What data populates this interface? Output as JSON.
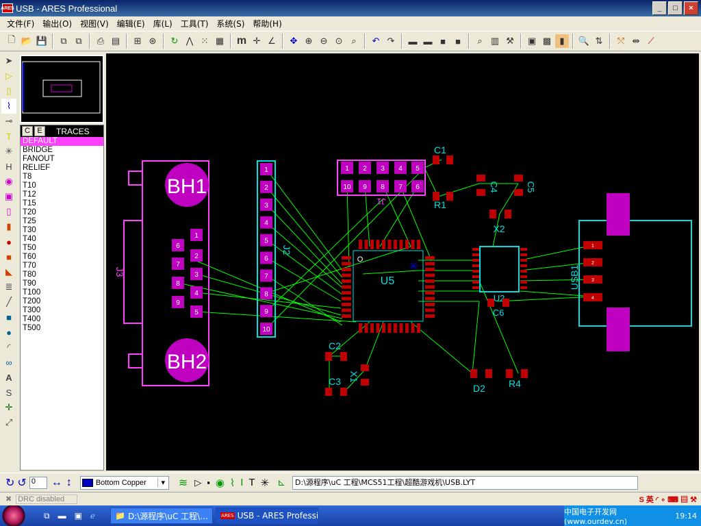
{
  "window": {
    "title": "USB - ARES Professional",
    "icon_text": "ARES"
  },
  "menu": [
    "文件(F)",
    "输出(O)",
    "视图(V)",
    "编辑(E)",
    "库(L)",
    "工具(T)",
    "系统(S)",
    "帮助(H)"
  ],
  "selector": {
    "tab_c": "C",
    "tab_e": "E",
    "title": "TRACES",
    "items": [
      "DEFAULT",
      "BRIDGE",
      "FANOUT",
      "RELIEF",
      "T8",
      "T10",
      "T12",
      "T15",
      "T20",
      "T25",
      "T30",
      "T40",
      "T50",
      "T60",
      "T70",
      "T80",
      "T90",
      "T100",
      "T200",
      "T300",
      "T400",
      "T500"
    ],
    "selected": "DEFAULT"
  },
  "status": {
    "rotation": "0",
    "layer": "Bottom Copper",
    "path": "D:\\源程序\\uC 工程\\MCS51工程\\超酷游戏机\\USB.LYT",
    "drc": "DRC disabled"
  },
  "taskbar": {
    "task1": "D:\\源程序\\uC 工程\\...",
    "task2": "USB - ARES Professi...",
    "tray_text": "中国电子开发网(www.ourdev.cn)",
    "clock": "19:14"
  },
  "pcb": {
    "labels": [
      "BH1",
      "BH2",
      "J3",
      "J2",
      "J1",
      "U5",
      "C1",
      "R1",
      "C4",
      "C5",
      "X2",
      "U2",
      "C6",
      "USB1",
      "C2",
      "X1",
      "C3",
      "D2",
      "R4"
    ],
    "j1_pins": [
      "1",
      "2",
      "3",
      "4",
      "5",
      "10",
      "9",
      "8",
      "7",
      "6"
    ],
    "j2_pins": [
      "1",
      "2",
      "3",
      "4",
      "5",
      "6",
      "7",
      "8",
      "9",
      "10"
    ],
    "j3_pins": [
      "1",
      "2",
      "3",
      "4",
      "5",
      "6",
      "7",
      "8",
      "9"
    ],
    "usb_pins": [
      "1",
      "2",
      "3",
      "4"
    ]
  },
  "colors": {
    "pad": "#c000c0",
    "outline": "#ff40ff",
    "silk": "#00e0e0",
    "ratsnest": "#00ff00",
    "smd": "#c00000"
  }
}
